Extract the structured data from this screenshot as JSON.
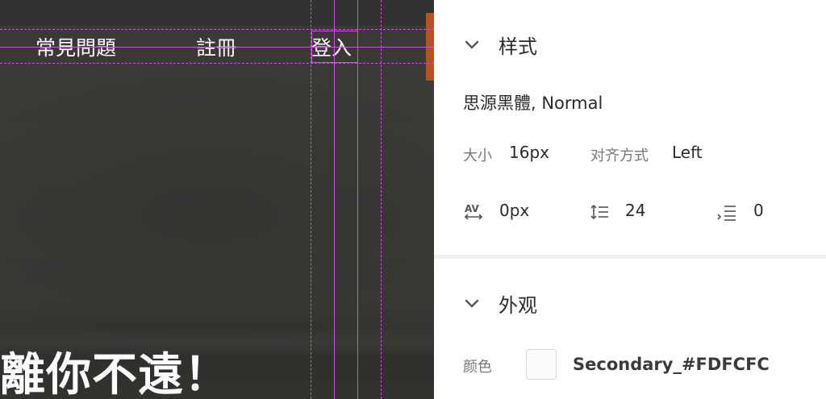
{
  "canvas": {
    "nav": {
      "faq": "常見問題",
      "register": "註冊",
      "login": "登入"
    },
    "hero_text": "離你不遠！",
    "guide_color": "#d24ee6",
    "accent_color": "#b4531f",
    "text_color": "#fdfcfc"
  },
  "panel": {
    "style_section": {
      "title": "样式",
      "font": "思源黑體, Normal",
      "size_label": "大小",
      "size_value": "16px",
      "align_label": "对齐方式",
      "align_value": "Left",
      "char_spacing_icon": "char-spacing-icon",
      "char_spacing_value": "0px",
      "line_spacing_icon": "line-spacing-icon",
      "line_spacing_value": "24",
      "paragraph_spacing_icon": "paragraph-spacing-icon",
      "paragraph_spacing_value": "0"
    },
    "appearance_section": {
      "title": "外观",
      "color_label": "颜色",
      "color_name": "Secondary_#FDFCFC",
      "color_value": "#FDFCFC"
    }
  }
}
